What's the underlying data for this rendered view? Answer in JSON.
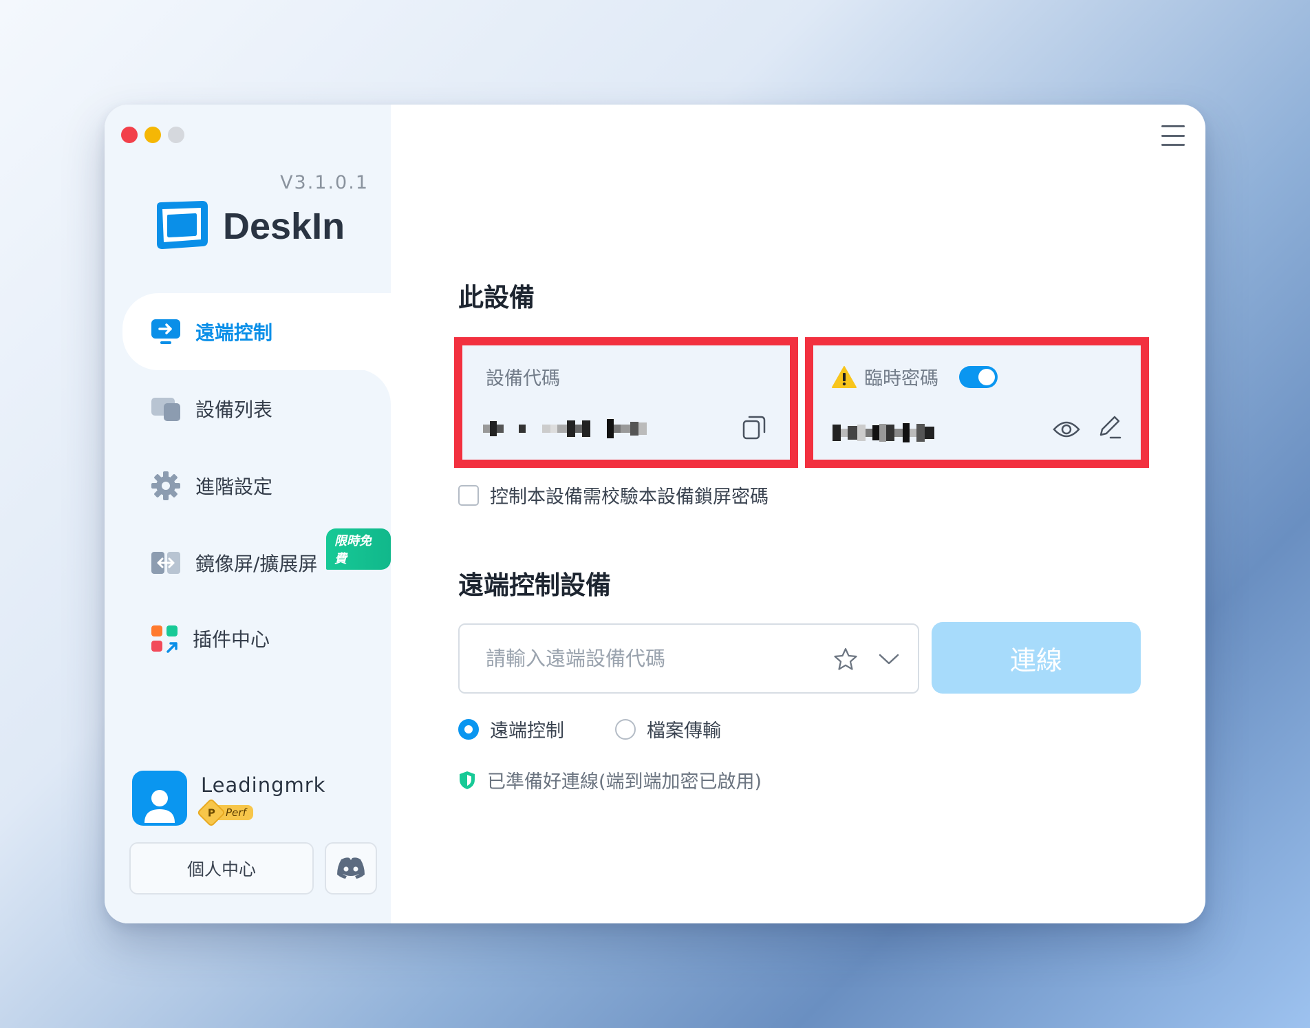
{
  "app": {
    "version": "V3.1.0.1",
    "brand_name": "DeskIn"
  },
  "sidebar": {
    "items": [
      {
        "label": "遠端控制",
        "icon": "remote-control-icon",
        "active": true
      },
      {
        "label": "設備列表",
        "icon": "device-list-icon",
        "active": false
      },
      {
        "label": "進階設定",
        "icon": "gear-icon",
        "active": false
      },
      {
        "label": "鏡像屏/擴展屏",
        "icon": "mirror-screen-icon",
        "active": false,
        "badge": "限時免費"
      },
      {
        "label": "插件中心",
        "icon": "plugin-center-icon",
        "active": false
      }
    ],
    "user": {
      "name": "Leadingmrk",
      "tier_badge": "P",
      "tier_label": "Perf"
    },
    "personal_center_label": "個人中心"
  },
  "main": {
    "this_device_title": "此設備",
    "device_code_label": "設備代碼",
    "temp_password_label": "臨時密碼",
    "temp_password_enabled": true,
    "lock_screen_checkbox_label": "控制本設備需校驗本設備鎖屏密碼",
    "lock_screen_checked": false,
    "remote_title": "遠端控制設備",
    "remote_input_placeholder": "請輸入遠端設備代碼",
    "remote_input_value": "",
    "connect_label": "連線",
    "modes": [
      {
        "label": "遠端控制",
        "selected": true
      },
      {
        "label": "檔案傳輸",
        "selected": false
      }
    ],
    "status_text": "已準備好連線(端到端加密已啟用)"
  },
  "colors": {
    "accent": "#0a96f0",
    "highlight_border": "#f2303f",
    "connect_disabled": "#a7dbfb",
    "secure_green": "#17c996"
  }
}
